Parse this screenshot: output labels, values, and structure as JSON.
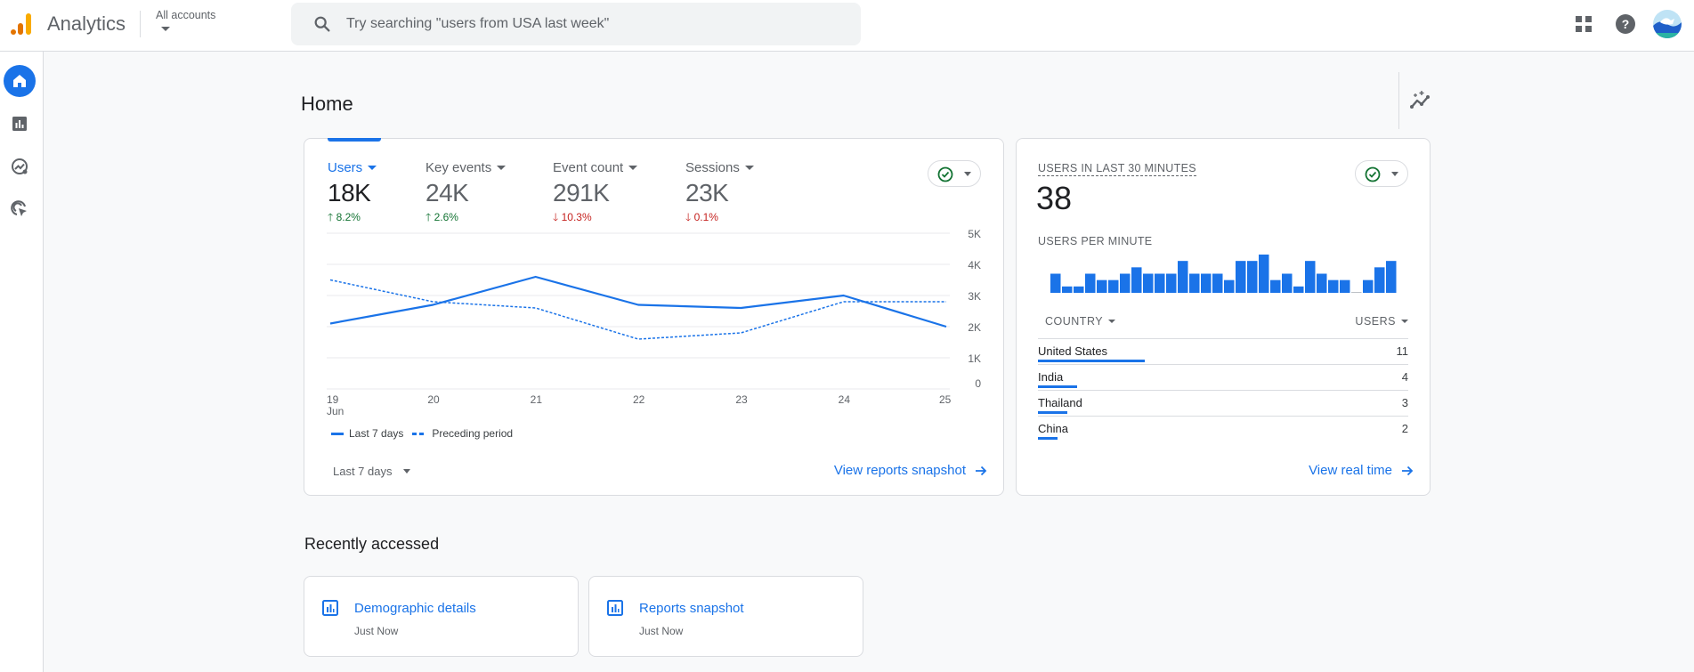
{
  "topbar": {
    "app_title": "Analytics",
    "account_selector": "All accounts",
    "search_placeholder": "Try searching \"users from USA last week\"",
    "icons": [
      "apps-grid-icon",
      "help-icon",
      "account-avatar"
    ]
  },
  "sidenav": {
    "items": [
      {
        "name": "home",
        "icon": "home-icon",
        "active": true
      },
      {
        "name": "reports",
        "icon": "bar-chart-icon",
        "active": false
      },
      {
        "name": "explore",
        "icon": "explore-icon",
        "active": false
      },
      {
        "name": "advertising",
        "icon": "advertising-icon",
        "active": false
      }
    ]
  },
  "page": {
    "title": "Home",
    "insights_icon": "insights-icon"
  },
  "overview_card": {
    "metrics": [
      {
        "label": "Users",
        "value": "18K",
        "change": "8.2%",
        "direction": "up",
        "active": true
      },
      {
        "label": "Key events",
        "value": "24K",
        "change": "2.6%",
        "direction": "up",
        "active": false
      },
      {
        "label": "Event count",
        "value": "291K",
        "change": "10.3%",
        "direction": "down",
        "active": false
      },
      {
        "label": "Sessions",
        "value": "23K",
        "change": "0.1%",
        "direction": "down",
        "active": false
      }
    ],
    "legend": {
      "current": "Last 7 days",
      "previous": "Preceding period"
    },
    "date_range": "Last 7 days",
    "link": "View reports snapshot"
  },
  "realtime_card": {
    "label": "USERS IN LAST 30 MINUTES",
    "value": "38",
    "sub_label": "USERS PER MINUTE",
    "col_country": "COUNTRY",
    "col_users": "USERS",
    "rows": [
      {
        "country": "United States",
        "users": 11
      },
      {
        "country": "India",
        "users": 4
      },
      {
        "country": "Thailand",
        "users": 3
      },
      {
        "country": "China",
        "users": 2
      }
    ],
    "link": "View real time"
  },
  "recently_accessed": {
    "title": "Recently accessed",
    "items": [
      {
        "title": "Demographic details",
        "time": "Just Now"
      },
      {
        "title": "Reports snapshot",
        "time": "Just Now"
      }
    ]
  },
  "colors": {
    "accent": "#1a73e8",
    "up": "#137333",
    "down": "#c5221f"
  },
  "chart_data": [
    {
      "type": "line",
      "title": "Users",
      "categories": [
        "19\nJun",
        "20",
        "21",
        "22",
        "23",
        "24",
        "25"
      ],
      "x_tick_labels": [
        "19",
        "20",
        "21",
        "22",
        "23",
        "24",
        "25"
      ],
      "x_sub_label": "Jun",
      "y_tick_labels": [
        "0",
        "1K",
        "2K",
        "3K",
        "4K",
        "5K"
      ],
      "ylim": [
        0,
        5000
      ],
      "grid": true,
      "legend_position": "bottom-left",
      "series": [
        {
          "name": "Last 7 days",
          "style": "solid",
          "values": [
            2100,
            2700,
            3600,
            2700,
            2600,
            3000,
            2000
          ]
        },
        {
          "name": "Preceding period",
          "style": "dashed",
          "values": [
            3500,
            2800,
            2600,
            1600,
            1800,
            2800,
            2800
          ]
        }
      ]
    },
    {
      "type": "bar",
      "title": "USERS PER MINUTE",
      "values": [
        3,
        1,
        1,
        3,
        2,
        2,
        3,
        4,
        3,
        3,
        3,
        5,
        3,
        3,
        3,
        2,
        5,
        5,
        6,
        2,
        3,
        1,
        5,
        3,
        2,
        2,
        0,
        2,
        4,
        5
      ],
      "ylim": [
        0,
        6
      ],
      "grid": false
    }
  ]
}
